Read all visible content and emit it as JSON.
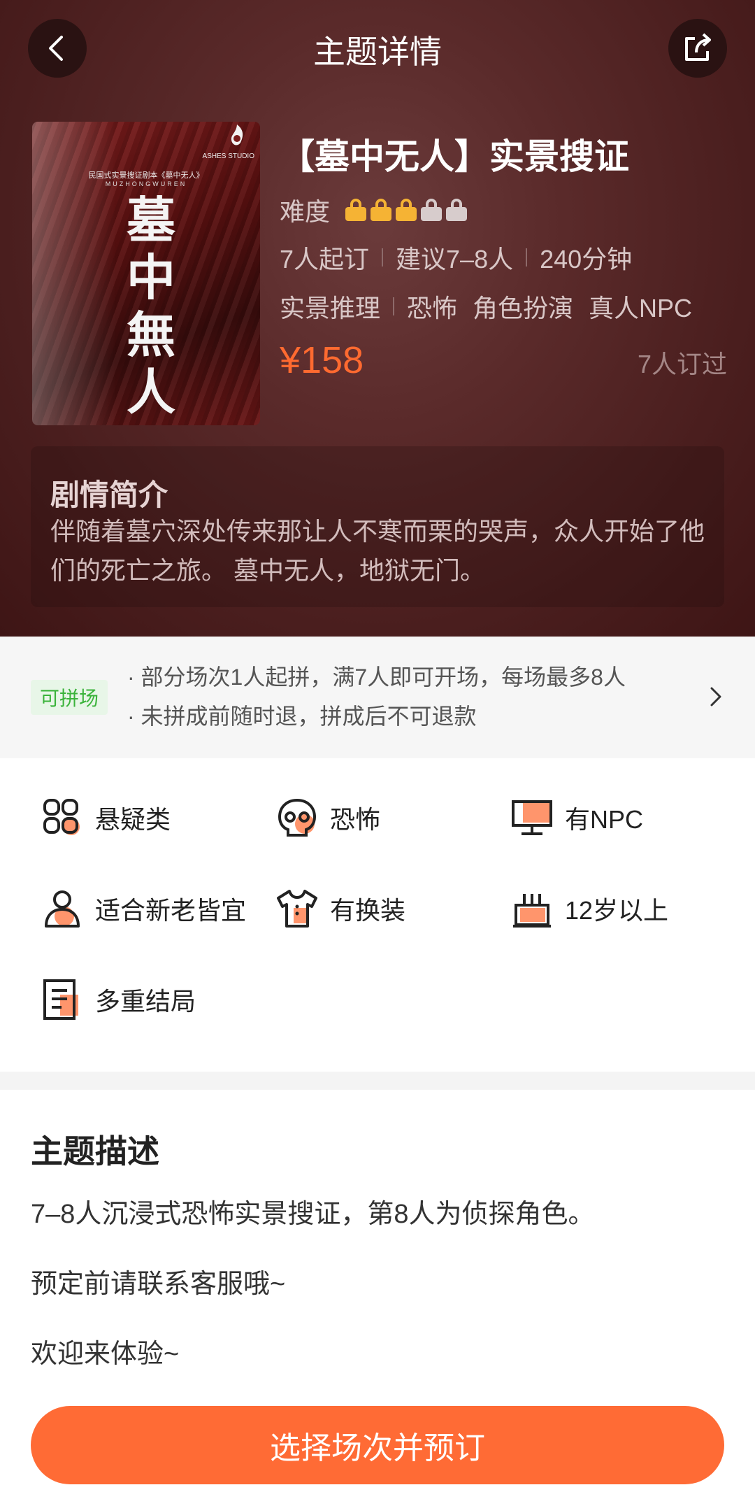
{
  "nav": {
    "title": "主题详情",
    "back_icon": "back-arrow-icon",
    "share_icon": "share-icon"
  },
  "poster": {
    "brand": "ASHES STUDIO",
    "subtitle": "民国式实景搜证剧本《墓中无人》",
    "pinyin": "MUZHONGWUREN",
    "calligraphy": "墓中無人"
  },
  "theme": {
    "title": "【墓中无人】实景搜证",
    "difficulty_label": "难度",
    "difficulty_level": 3,
    "difficulty_max": 5,
    "min_people": "7人起订",
    "suggest": "建议7–8人",
    "duration": "240分钟",
    "tags": [
      "实景推理",
      "恐怖",
      "角色扮演",
      "真人NPC"
    ],
    "price": "¥158",
    "booked_count": "7人订过",
    "accent_color": "#ff6a30"
  },
  "synopsis": {
    "title": "剧情简介",
    "text": "伴随着墓穴深处传来那让人不寒而栗的哭声，众人开始了他们的死亡之旅。 墓中无人，地狱无门。"
  },
  "group_buy": {
    "badge": "可拼场",
    "lines": [
      "· 部分场次1人起拼，满7人即可开场，每场最多8人",
      "· 未拼成前随时退，拼成后不可退款"
    ]
  },
  "features": [
    {
      "icon": "puzzle-grid-icon",
      "label": "悬疑类"
    },
    {
      "icon": "skull-icon",
      "label": "恐怖"
    },
    {
      "icon": "monitor-icon",
      "label": "有NPC"
    },
    {
      "icon": "person-icon",
      "label": "适合新老皆宜"
    },
    {
      "icon": "tshirt-icon",
      "label": "有换装"
    },
    {
      "icon": "cake-icon",
      "label": "12岁以上"
    },
    {
      "icon": "document-icon",
      "label": "多重结局"
    }
  ],
  "description": {
    "title": "主题描述",
    "lines": [
      "7–8人沉浸式恐怖实景搜证，第8人为侦探角色。",
      "预定前请联系客服哦~",
      "欢迎来体验~"
    ]
  },
  "cta": {
    "label": "选择场次并预订",
    "color": "#ff6b35"
  }
}
